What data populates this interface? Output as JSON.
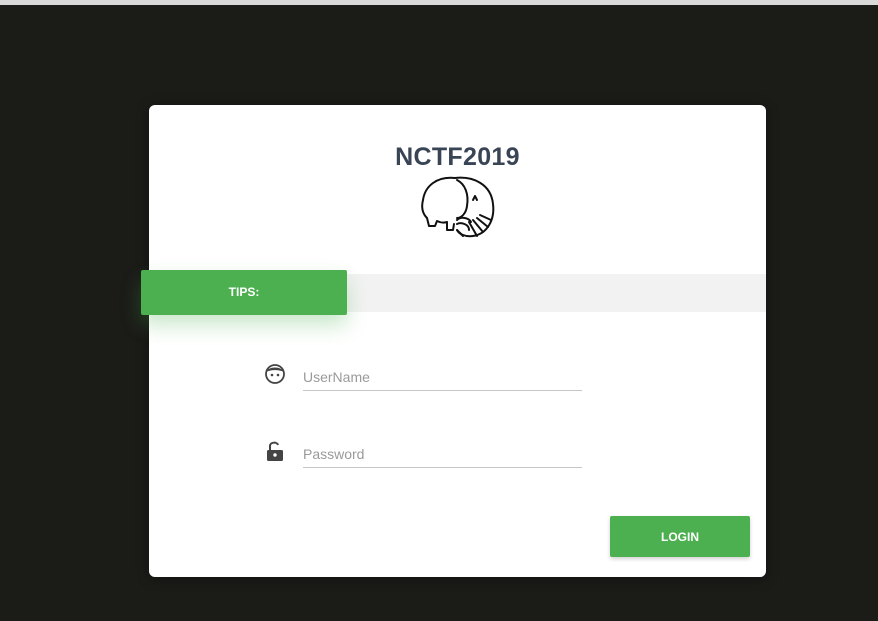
{
  "page": {
    "title": "NCTF2019",
    "logo_icon": "php-elephant-icon"
  },
  "tips": {
    "label": "TIPS:"
  },
  "form": {
    "username": {
      "icon": "user-face-icon",
      "placeholder": "UserName",
      "value": ""
    },
    "password": {
      "icon": "unlocked-padlock-icon",
      "placeholder": "Password",
      "value": ""
    },
    "login_label": "LOGIN"
  },
  "colors": {
    "background": "#1b1b18",
    "card": "#ffffff",
    "accent_green": "#4caf50",
    "title": "#394455",
    "tips_band": "#f2f2f2"
  }
}
